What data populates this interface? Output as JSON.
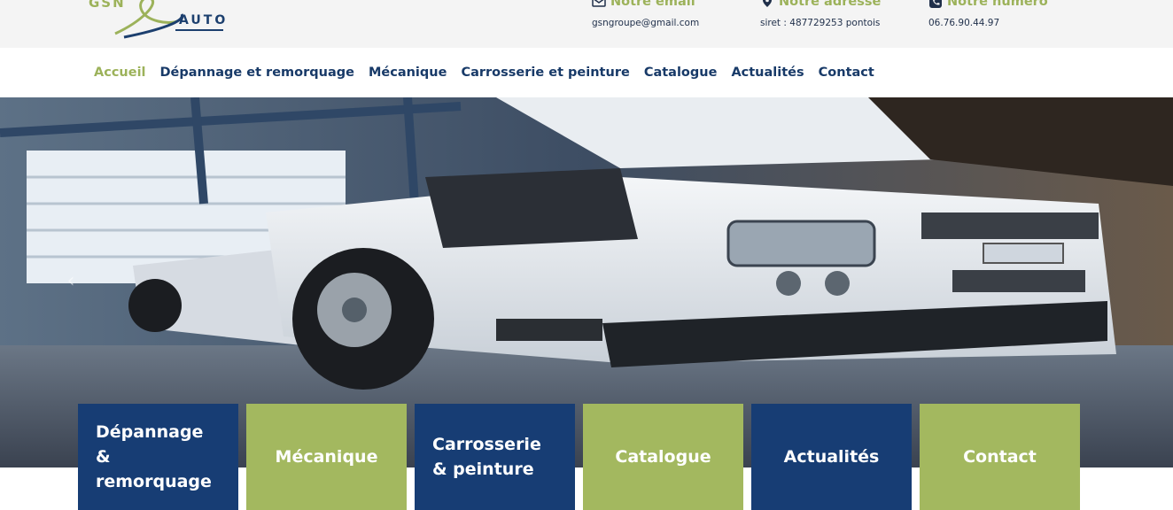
{
  "brand": {
    "logo_left": "GSN",
    "logo_right": "AUTO"
  },
  "contact": {
    "email": {
      "title": "Notre email",
      "value": "gsngroupe@gmail.com",
      "icon": "envelope-icon"
    },
    "address": {
      "title": "Notre adresse",
      "value": "siret : 487729253 pontois",
      "icon": "map-pin-icon"
    },
    "phone": {
      "title": "Notre numéro",
      "value": "06.76.90.44.97",
      "icon": "phone-icon"
    }
  },
  "nav": {
    "items": [
      {
        "label": "Accueil",
        "active": true
      },
      {
        "label": "Dépannage et remorquage"
      },
      {
        "label": "Mécanique"
      },
      {
        "label": "Carrosserie et peinture"
      },
      {
        "label": "Catalogue"
      },
      {
        "label": "Actualités"
      },
      {
        "label": "Contact"
      }
    ]
  },
  "hero": {
    "arrow": "‹"
  },
  "tiles": [
    {
      "label_lines": [
        "Dépannage",
        "&",
        "remorquage"
      ]
    },
    {
      "label": "Mécanique"
    },
    {
      "label_lines": [
        "Carrosserie",
        "& peinture"
      ]
    },
    {
      "label": "Catalogue"
    },
    {
      "label": "Actualités"
    },
    {
      "label": "Contact"
    }
  ],
  "colors": {
    "accent_green": "#9cb25a",
    "brand_blue": "#173d74",
    "topbar_bg": "#f4f4f4"
  }
}
